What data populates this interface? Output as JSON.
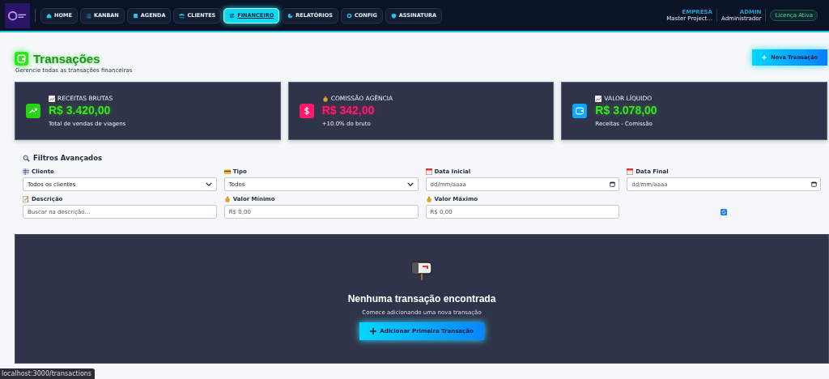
{
  "nav": {
    "tabs": [
      {
        "label": "HOME",
        "selected": false
      },
      {
        "label": "KANBAN",
        "selected": false
      },
      {
        "label": "AGENDA",
        "selected": false
      },
      {
        "label": "CLIENTES",
        "selected": false
      },
      {
        "label": "FINANCEIRO",
        "selected": true
      },
      {
        "label": "RELATÓRIOS",
        "selected": false
      },
      {
        "label": "CONFIG",
        "selected": false
      },
      {
        "label": "ASSINATURA",
        "selected": false
      }
    ],
    "user_info": [
      {
        "label": "EMPRESA",
        "value": "Master Project..."
      },
      {
        "label": "ADMIN",
        "value": "Administrador"
      }
    ],
    "license_badge": "Licença Ativa"
  },
  "page": {
    "title": "Transações",
    "subtitle": "Gerencie todas as transações financeiras",
    "new_button": "Nova Transação"
  },
  "cards": [
    {
      "label": "RECEITAS BRUTAS",
      "value": "R$ 3.420,00",
      "note": "Total de vendas de viagens",
      "color": "#39e61e"
    },
    {
      "label": "COMISSÃO AGÊNCIA",
      "value": "R$ 342,00",
      "note": "+10.0% do bruto",
      "color": "#ff1a6c"
    },
    {
      "label": "VALOR LÍQUIDO",
      "value": "R$ 3.078,00",
      "note": "Receitas - Comissão",
      "color": "#39e61e"
    }
  ],
  "filters": {
    "title": "Filtros Avançados",
    "fields": [
      {
        "label": "Cliente",
        "kind": "select",
        "value": "Todos os clientes"
      },
      {
        "label": "Tipo",
        "kind": "select",
        "value": "Todos"
      },
      {
        "label": "Data Inicial",
        "kind": "date",
        "placeholder": "dd/mm/aaaa"
      },
      {
        "label": "Data Final",
        "kind": "date",
        "placeholder": "dd/mm/aaaa"
      },
      {
        "label": "Descrição",
        "kind": "text",
        "placeholder": "Buscar na descrição..."
      },
      {
        "label": "Valor Mínimo",
        "kind": "text",
        "placeholder": "R$ 0,00"
      },
      {
        "label": "Valor Máximo",
        "kind": "text",
        "placeholder": "R$ 0,00"
      }
    ]
  },
  "empty_state": {
    "title": "Nenhuma transação encontrada",
    "text": "Comece adicionando uma nova transação",
    "button": "Adicionar Primeira Transação"
  },
  "status_url": "localhost:3000/transactions"
}
